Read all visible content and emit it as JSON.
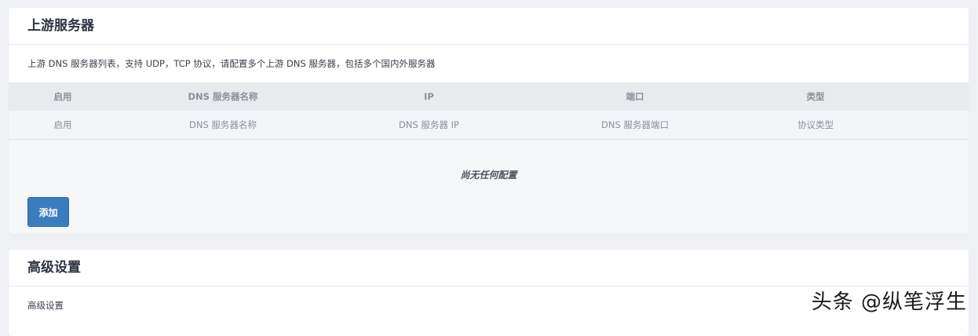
{
  "upstream": {
    "title": "上游服务器",
    "description": "上游 DNS 服务器列表，支持 UDP，TCP 协议，请配置多个上游 DNS 服务器，包括多个国内外服务器",
    "columns": [
      "启用",
      "DNS 服务器名称",
      "IP",
      "端口",
      "类型"
    ],
    "column_descriptions": [
      "启用",
      "DNS 服务器名称",
      "DNS 服务器 IP",
      "DNS 服务器端口",
      "协议类型"
    ],
    "empty_text": "尚无任何配置",
    "add_label": "添加"
  },
  "advanced": {
    "title": "高级设置",
    "description": "高级设置"
  },
  "watermark": "头条 @纵笔浮生",
  "colors": {
    "accent": "#3a7dbf",
    "background": "#eef0f3"
  }
}
